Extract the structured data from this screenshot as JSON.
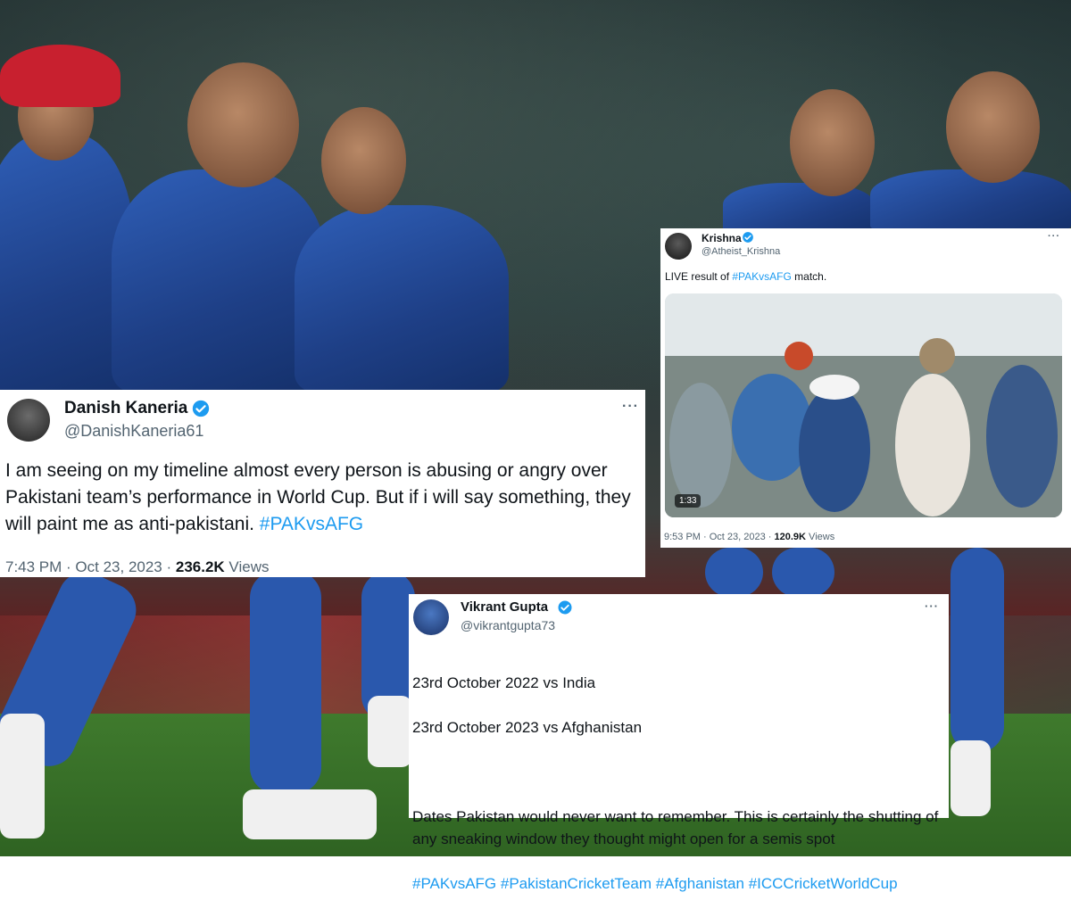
{
  "tweet_danish": {
    "name": "Danish Kaneria",
    "handle": "@DanishKaneria61",
    "text": "I am seeing on my timeline almost every person is abusing or angry over Pakistani team’s performance in World Cup. But if i will say something, they will paint me as anti-pakistani. ",
    "hashtag": "#PAKvsAFG",
    "time": "7:43 PM · Oct 23, 2023 · ",
    "views_count": "236.2K",
    "views_label": " Views",
    "more": "···"
  },
  "tweet_krishna": {
    "name": "Krishna",
    "handle": "@Atheist_Krishna",
    "text_before": "LIVE result of ",
    "hashtag": "#PAKvsAFG",
    "text_after": " match.",
    "video_duration": "1:33",
    "time": "9:53 PM · Oct 23, 2023 · ",
    "views_count": "120.9K",
    "views_label": " Views",
    "more": "···"
  },
  "tweet_vikrant": {
    "name": "Vikrant Gupta",
    "handle": "@vikrantgupta73",
    "line1": "23rd October 2022 vs India",
    "line2": "23rd October 2023 vs Afghanistan",
    "line3": "Dates Pakistan would never want to remember. This is certainly the shutting of any sneaking window they thought might open for a semis spot",
    "hashtags": "#PAKvsAFG #PakistanCricketTeam #Afghanistan #ICCCricketWorldCup",
    "more": "···"
  },
  "colors": {
    "link": "#1d9bf0",
    "verified": "#1d9bf0",
    "muted": "#536471"
  }
}
